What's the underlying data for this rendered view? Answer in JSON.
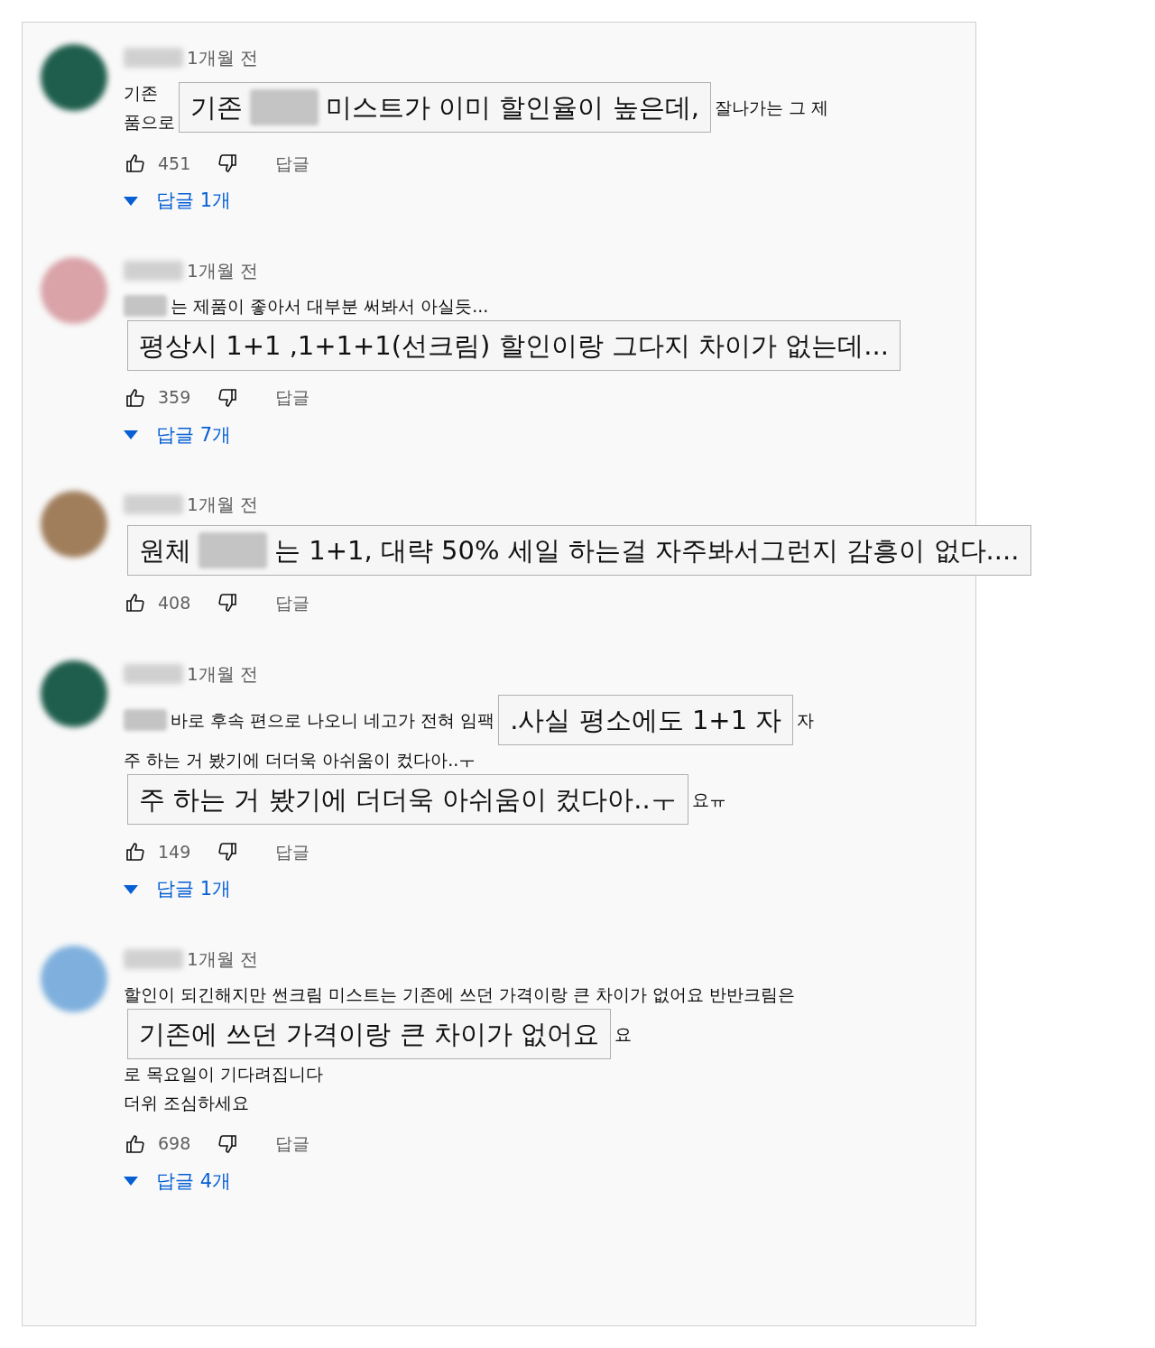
{
  "comments": [
    {
      "time": "1개월 전",
      "lines": [
        {
          "items": [
            {
              "kind": "text",
              "lines": [
                "기존",
                "품으로"
              ]
            },
            {
              "kind": "callout",
              "parts": [
                {
                  "kind": "text",
                  "text": "기존"
                },
                {
                  "kind": "redaction"
                },
                {
                  "kind": "text",
                  "text": "미스트가 이미 할인율이 높은데,"
                }
              ]
            },
            {
              "kind": "text",
              "lines": [
                "잘나가는 그 제"
              ]
            }
          ]
        }
      ],
      "likes": "451",
      "reply": "답글",
      "replies": "답글 1개"
    },
    {
      "time": "1개월 전",
      "lines": [
        {
          "items": [
            {
              "kind": "redaction"
            },
            {
              "kind": "text",
              "lines": [
                "는 제품이 좋아서 대부분 써봐서 아실듯..."
              ]
            }
          ]
        },
        {
          "items": [
            {
              "kind": "callout",
              "parts": [
                {
                  "kind": "text",
                  "text": "평상시 1+1 ,1+1+1(선크림) 할인이랑 그다지 차이가 없는데..."
                }
              ]
            }
          ]
        }
      ],
      "likes": "359",
      "reply": "답글",
      "replies": "답글 7개"
    },
    {
      "time": "1개월 전",
      "lines": [
        {
          "items": [
            {
              "kind": "callout",
              "parts": [
                {
                  "kind": "text",
                  "text": "원체"
                },
                {
                  "kind": "redaction"
                },
                {
                  "kind": "text",
                  "text": "는 1+1, 대략 50% 세일 하는걸 자주봐서그런지 감흥이 없다...."
                }
              ]
            }
          ]
        }
      ],
      "likes": "408",
      "reply": "답글"
    },
    {
      "time": "1개월 전",
      "lines": [
        {
          "items": [
            {
              "kind": "redaction"
            },
            {
              "kind": "text",
              "lines": [
                "바로 후속 편으로 나오니 네고가 전혀 임팩"
              ]
            },
            {
              "kind": "callout",
              "parts": [
                {
                  "kind": "text",
                  "text": ".사실 평소에도 1+1 자"
                }
              ]
            },
            {
              "kind": "text",
              "lines": [
                "자"
              ]
            }
          ]
        },
        {
          "items": [
            {
              "kind": "text",
              "lines": [
                "주 하는 거 봤기에 더더욱 아쉬움이 컸다아..ㅜ"
              ]
            }
          ]
        },
        {
          "items": [
            {
              "kind": "callout",
              "parts": [
                {
                  "kind": "text",
                  "text": "주 하는 거 봤기에 더더욱 아쉬움이 컸다아..ㅜ"
                }
              ]
            },
            {
              "kind": "text",
              "lines": [
                "요ㅠ"
              ]
            }
          ]
        }
      ],
      "likes": "149",
      "reply": "답글",
      "replies": "답글 1개"
    },
    {
      "time": "1개월 전",
      "lines": [
        {
          "items": [
            {
              "kind": "text",
              "lines": [
                "할인이 되긴해지만 썬크림 미스트는 기존에 쓰던 가격이랑 큰 차이가 없어요 반반크림은"
              ]
            }
          ]
        },
        {
          "items": [
            {
              "kind": "callout",
              "parts": [
                {
                  "kind": "text",
                  "text": "기존에 쓰던 가격이랑 큰 차이가 없어요"
                }
              ]
            },
            {
              "kind": "text",
              "lines": [
                "요"
              ]
            }
          ]
        },
        {
          "items": [
            {
              "kind": "text",
              "lines": [
                "로 목요일이 기다려집니다"
              ]
            }
          ]
        },
        {
          "items": [
            {
              "kind": "text",
              "lines": [
                "더위 조심하세요"
              ]
            }
          ]
        }
      ],
      "likes": "698",
      "reply": "답글",
      "replies": "답글 4개"
    }
  ]
}
